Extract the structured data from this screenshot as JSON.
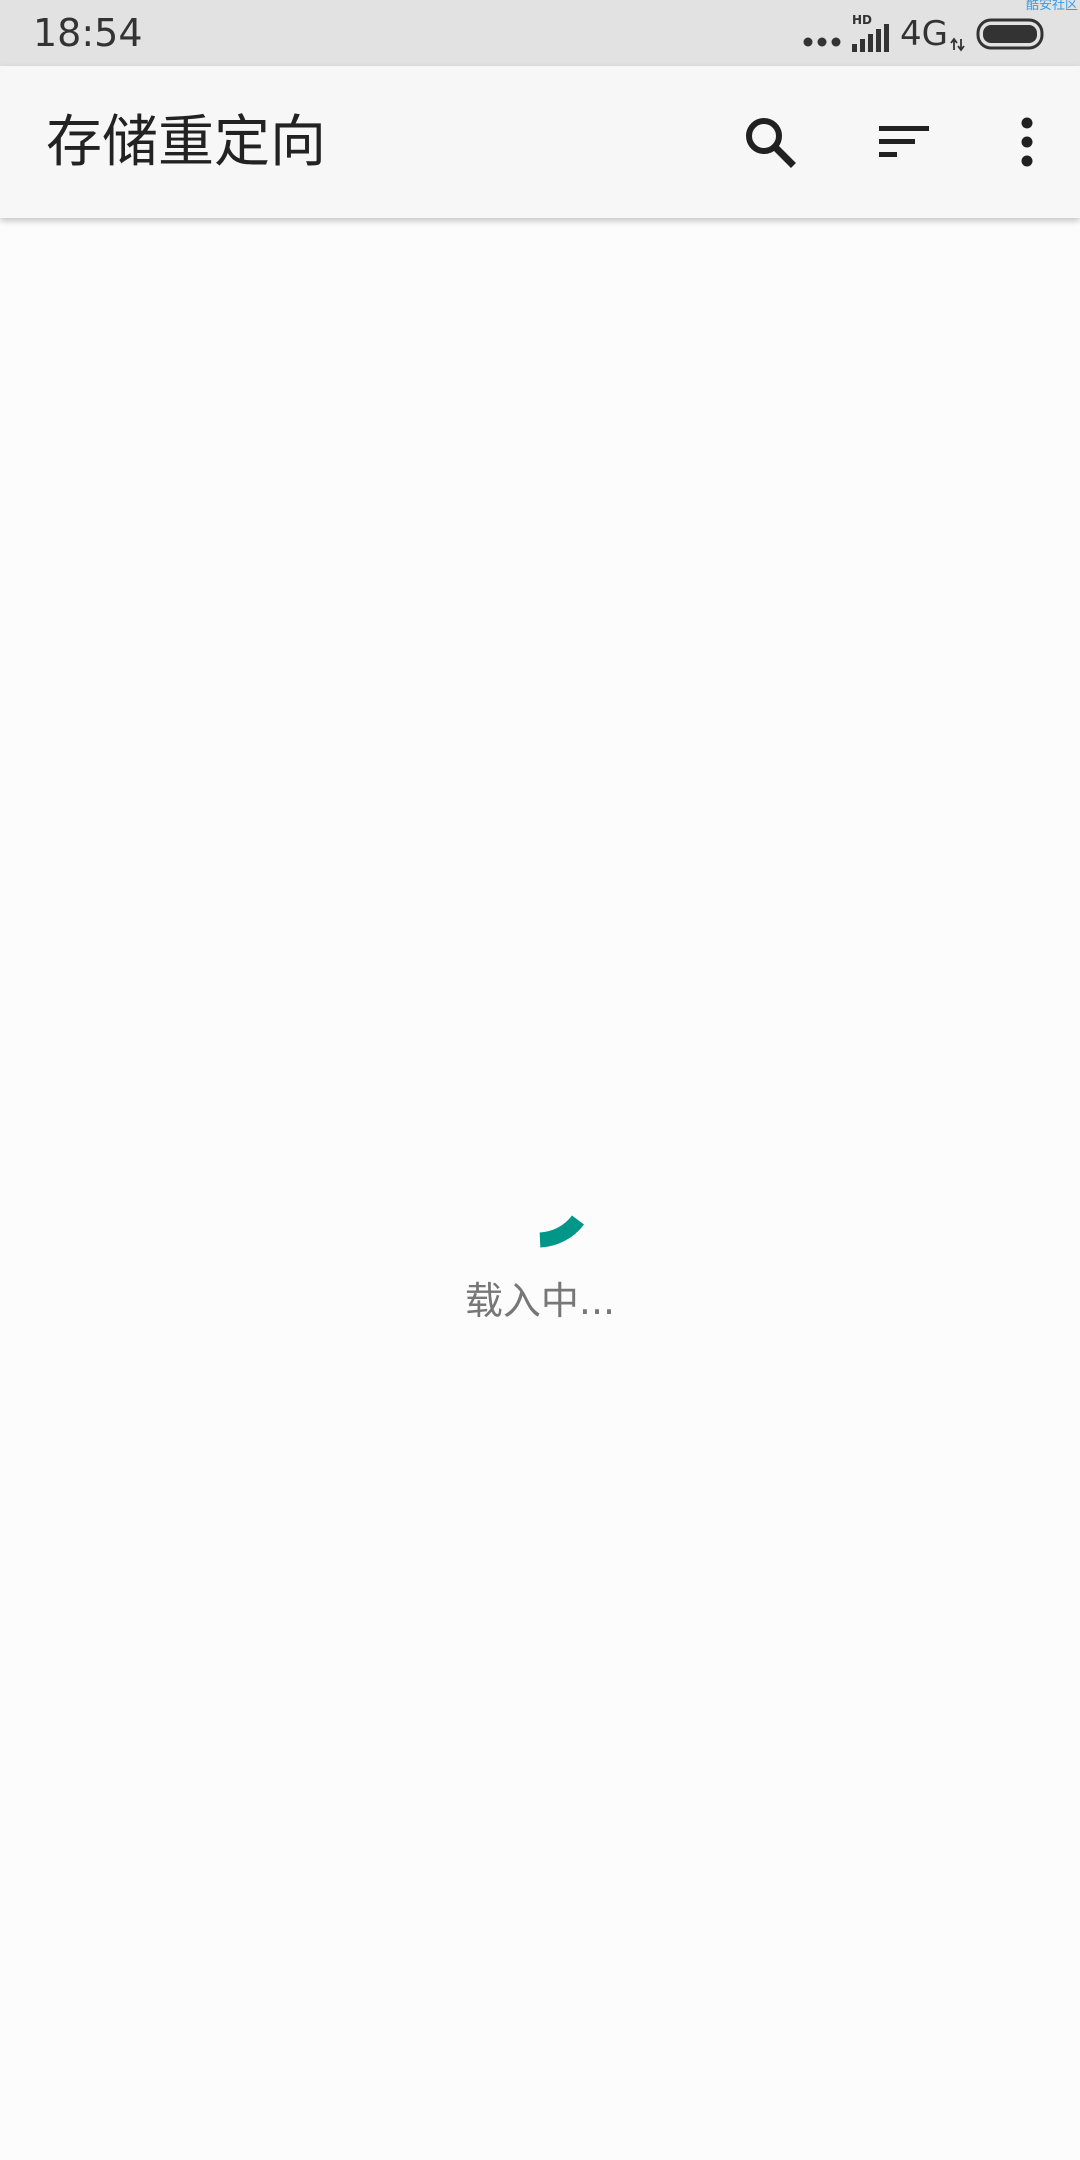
{
  "status_bar": {
    "time": "18:54",
    "network": "4G",
    "signal_badge": "HD",
    "watermark": "酷安社区",
    "icons": {
      "dots": "more-dots-icon",
      "signal": "signal-strength-icon",
      "arrows": "data-arrows-icon",
      "battery": "battery-icon"
    }
  },
  "toolbar": {
    "title": "存储重定向",
    "actions": {
      "search": "search-icon",
      "sort": "sort-icon",
      "more": "more-vert-icon"
    }
  },
  "content": {
    "loading_text": "载入中..."
  },
  "colors": {
    "accent": "#009688",
    "toolbar_bg": "#f7f7f7",
    "status_bar_bg": "#e2e2e2",
    "page_bg": "#fcfcfc",
    "loading_text": "#777777"
  }
}
